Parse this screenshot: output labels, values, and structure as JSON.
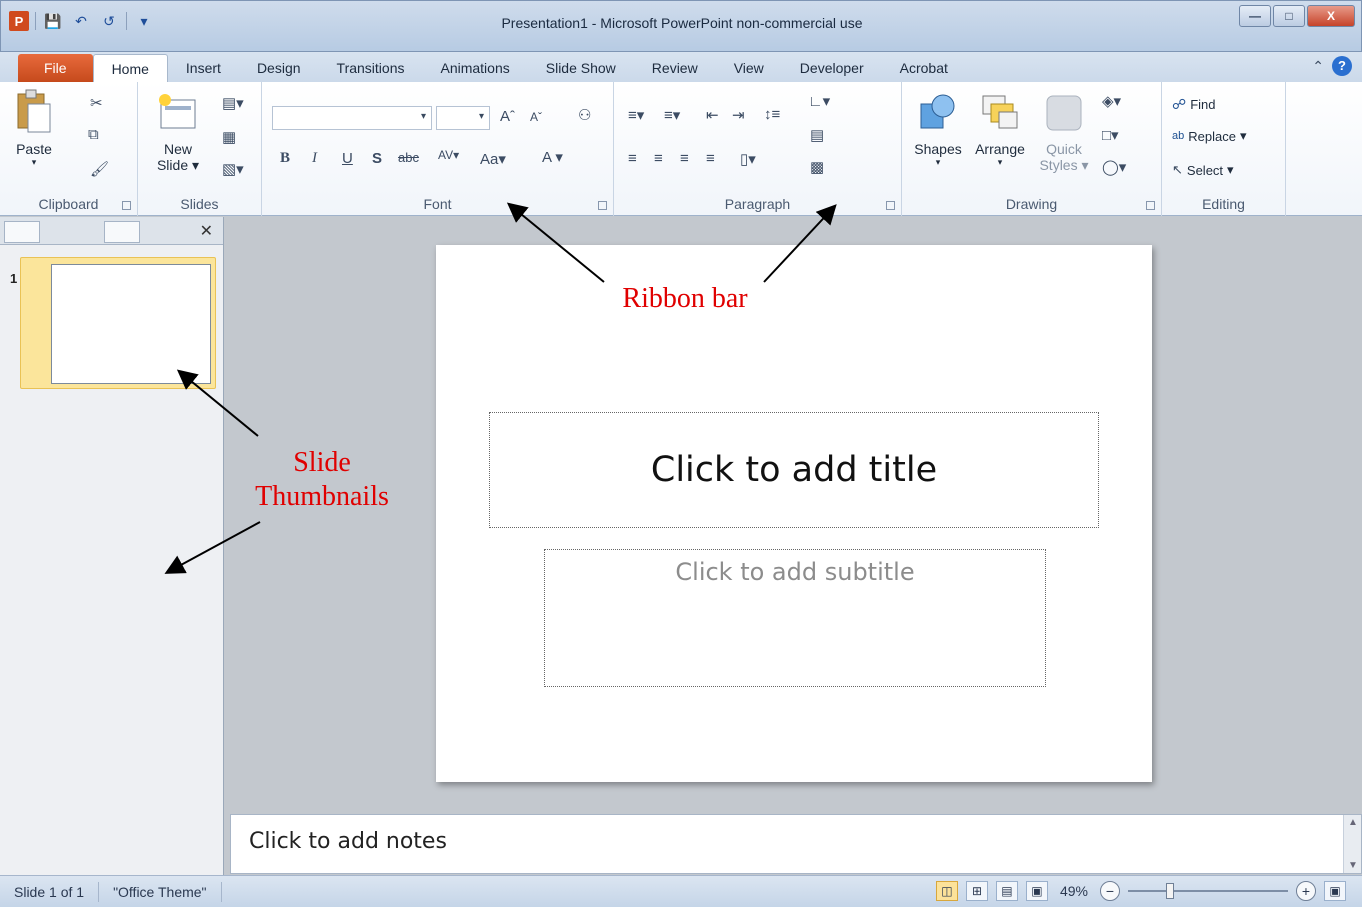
{
  "window": {
    "title": "Presentation1  -  Microsoft PowerPoint non-commercial use",
    "app_icon_letter": "P"
  },
  "tabs": [
    {
      "label": "File"
    },
    {
      "label": "Home"
    },
    {
      "label": "Insert"
    },
    {
      "label": "Design"
    },
    {
      "label": "Transitions"
    },
    {
      "label": "Animations"
    },
    {
      "label": "Slide Show"
    },
    {
      "label": "Review"
    },
    {
      "label": "View"
    },
    {
      "label": "Developer"
    },
    {
      "label": "Acrobat"
    }
  ],
  "ribbon": {
    "clipboard": {
      "label": "Clipboard",
      "paste": "Paste"
    },
    "slides": {
      "label": "Slides",
      "new_slide_line1": "New",
      "new_slide_line2": "Slide"
    },
    "font": {
      "label": "Font"
    },
    "paragraph": {
      "label": "Paragraph"
    },
    "drawing": {
      "label": "Drawing",
      "shapes": "Shapes",
      "arrange": "Arrange",
      "quick_styles_line1": "Quick",
      "quick_styles_line2": "Styles"
    },
    "editing": {
      "label": "Editing",
      "find": "Find",
      "replace": "Replace",
      "select": "Select"
    }
  },
  "thumbnails": {
    "items": [
      {
        "number": "1"
      }
    ]
  },
  "slide": {
    "title_placeholder": "Click to add title",
    "subtitle_placeholder": "Click to add subtitle"
  },
  "notes": {
    "placeholder": "Click to add notes"
  },
  "statusbar": {
    "slide_counter": "Slide 1 of 1",
    "theme": "\"Office Theme\"",
    "zoom": "49%"
  },
  "annotations": {
    "ribbon_bar": "Ribbon bar",
    "slide_thumbnails_line1": "Slide",
    "slide_thumbnails_line2": "Thumbnails",
    "color": "#e00000"
  }
}
